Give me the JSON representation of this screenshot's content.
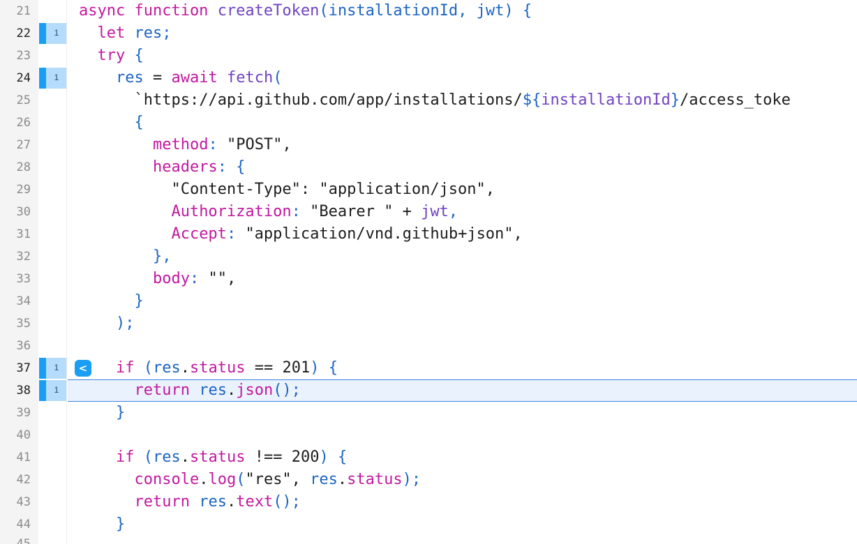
{
  "editor": {
    "lines": [
      {
        "num": "21",
        "segs": [
          [
            "kw",
            "async function "
          ],
          [
            "fn",
            "createToken"
          ],
          [
            "pu",
            "("
          ],
          [
            "id",
            "installationId"
          ],
          [
            "pu",
            ", "
          ],
          [
            "id",
            "jwt"
          ],
          [
            "pu",
            ") {"
          ]
        ]
      },
      {
        "num": "22",
        "active": true,
        "coverage": "1",
        "segs": [
          [
            "sp",
            "  "
          ],
          [
            "kw",
            "let "
          ],
          [
            "id",
            "res"
          ],
          [
            "pu",
            ";"
          ]
        ]
      },
      {
        "num": "23",
        "segs": [
          [
            "sp",
            "  "
          ],
          [
            "kw",
            "try "
          ],
          [
            "pu",
            "{"
          ]
        ]
      },
      {
        "num": "24",
        "active": true,
        "coverage": "1",
        "segs": [
          [
            "sp",
            "    "
          ],
          [
            "id",
            "res"
          ],
          [
            "str",
            " = "
          ],
          [
            "kw",
            "await "
          ],
          [
            "fn",
            "fetch"
          ],
          [
            "pu",
            "("
          ]
        ]
      },
      {
        "num": "25",
        "segs": [
          [
            "sp",
            "      "
          ],
          [
            "str",
            "`https://api.github.com/app/installations/"
          ],
          [
            "pu",
            "${"
          ],
          [
            "fn",
            "installationId"
          ],
          [
            "pu",
            "}"
          ],
          [
            "str",
            "/access_toke"
          ]
        ]
      },
      {
        "num": "26",
        "segs": [
          [
            "sp",
            "      "
          ],
          [
            "pu",
            "{"
          ]
        ]
      },
      {
        "num": "27",
        "segs": [
          [
            "sp",
            "        "
          ],
          [
            "pr",
            "method"
          ],
          [
            "pu",
            ": "
          ],
          [
            "str",
            "\"POST\","
          ]
        ]
      },
      {
        "num": "28",
        "segs": [
          [
            "sp",
            "        "
          ],
          [
            "pr",
            "headers"
          ],
          [
            "pu",
            ": {"
          ]
        ]
      },
      {
        "num": "29",
        "segs": [
          [
            "sp",
            "          "
          ],
          [
            "str",
            "\"Content-Type\": \"application/json\","
          ]
        ]
      },
      {
        "num": "30",
        "segs": [
          [
            "sp",
            "          "
          ],
          [
            "pr",
            "Authorization"
          ],
          [
            "pu",
            ": "
          ],
          [
            "str",
            "\"Bearer \" + "
          ],
          [
            "fn",
            "jwt"
          ],
          [
            "pu",
            ","
          ]
        ]
      },
      {
        "num": "31",
        "segs": [
          [
            "sp",
            "          "
          ],
          [
            "pr",
            "Accept"
          ],
          [
            "pu",
            ": "
          ],
          [
            "str",
            "\"application/vnd.github+json\","
          ]
        ]
      },
      {
        "num": "32",
        "segs": [
          [
            "sp",
            "        "
          ],
          [
            "pu",
            "},"
          ]
        ]
      },
      {
        "num": "33",
        "segs": [
          [
            "sp",
            "        "
          ],
          [
            "pr",
            "body"
          ],
          [
            "pu",
            ": "
          ],
          [
            "str",
            "\"\","
          ]
        ]
      },
      {
        "num": "34",
        "segs": [
          [
            "sp",
            "      "
          ],
          [
            "pu",
            "}"
          ]
        ]
      },
      {
        "num": "35",
        "segs": [
          [
            "sp",
            "    "
          ],
          [
            "pu",
            ");"
          ]
        ]
      },
      {
        "num": "36",
        "segs": []
      },
      {
        "num": "37",
        "active": true,
        "coverage": "1",
        "breakpoint": "<",
        "segs": [
          [
            "sp",
            "    "
          ],
          [
            "kw",
            "if "
          ],
          [
            "pu",
            "("
          ],
          [
            "id",
            "res"
          ],
          [
            "str",
            "."
          ],
          [
            "kw",
            "status"
          ],
          [
            "str",
            " == "
          ],
          [
            "num",
            "201"
          ],
          [
            "pu",
            ") {"
          ]
        ]
      },
      {
        "num": "38",
        "active": true,
        "coverage": "1",
        "highlight": true,
        "segs": [
          [
            "sp",
            "      "
          ],
          [
            "kw",
            "return "
          ],
          [
            "id",
            "res"
          ],
          [
            "str",
            "."
          ],
          [
            "kw",
            "json"
          ],
          [
            "pu",
            "();"
          ]
        ]
      },
      {
        "num": "39",
        "segs": [
          [
            "sp",
            "    "
          ],
          [
            "pu",
            "}"
          ]
        ]
      },
      {
        "num": "40",
        "segs": []
      },
      {
        "num": "41",
        "segs": [
          [
            "sp",
            "    "
          ],
          [
            "kw",
            "if "
          ],
          [
            "pu",
            "("
          ],
          [
            "id",
            "res"
          ],
          [
            "str",
            "."
          ],
          [
            "kw",
            "status"
          ],
          [
            "str",
            " !== "
          ],
          [
            "num",
            "200"
          ],
          [
            "pu",
            ") {"
          ]
        ]
      },
      {
        "num": "42",
        "segs": [
          [
            "sp",
            "      "
          ],
          [
            "kw",
            "console"
          ],
          [
            "str",
            "."
          ],
          [
            "kw",
            "log"
          ],
          [
            "pu",
            "("
          ],
          [
            "str",
            "\"res\", "
          ],
          [
            "id",
            "res"
          ],
          [
            "str",
            "."
          ],
          [
            "kw",
            "status"
          ],
          [
            "pu",
            ");"
          ]
        ]
      },
      {
        "num": "43",
        "segs": [
          [
            "sp",
            "      "
          ],
          [
            "kw",
            "return "
          ],
          [
            "id",
            "res"
          ],
          [
            "str",
            "."
          ],
          [
            "kw",
            "text"
          ],
          [
            "pu",
            "();"
          ]
        ]
      },
      {
        "num": "44",
        "segs": [
          [
            "sp",
            "    "
          ],
          [
            "pu",
            "}"
          ]
        ]
      }
    ],
    "partial_line_number": "45",
    "colors": {
      "keyword": "#c2189e",
      "function": "#6f42c1",
      "identifier": "#1b64c2",
      "coverage_bar": "#1a9ef3",
      "coverage_bg": "#b5dcfa",
      "current_line_bg": "#eaf2fd",
      "current_line_border": "#3b82dc"
    }
  }
}
